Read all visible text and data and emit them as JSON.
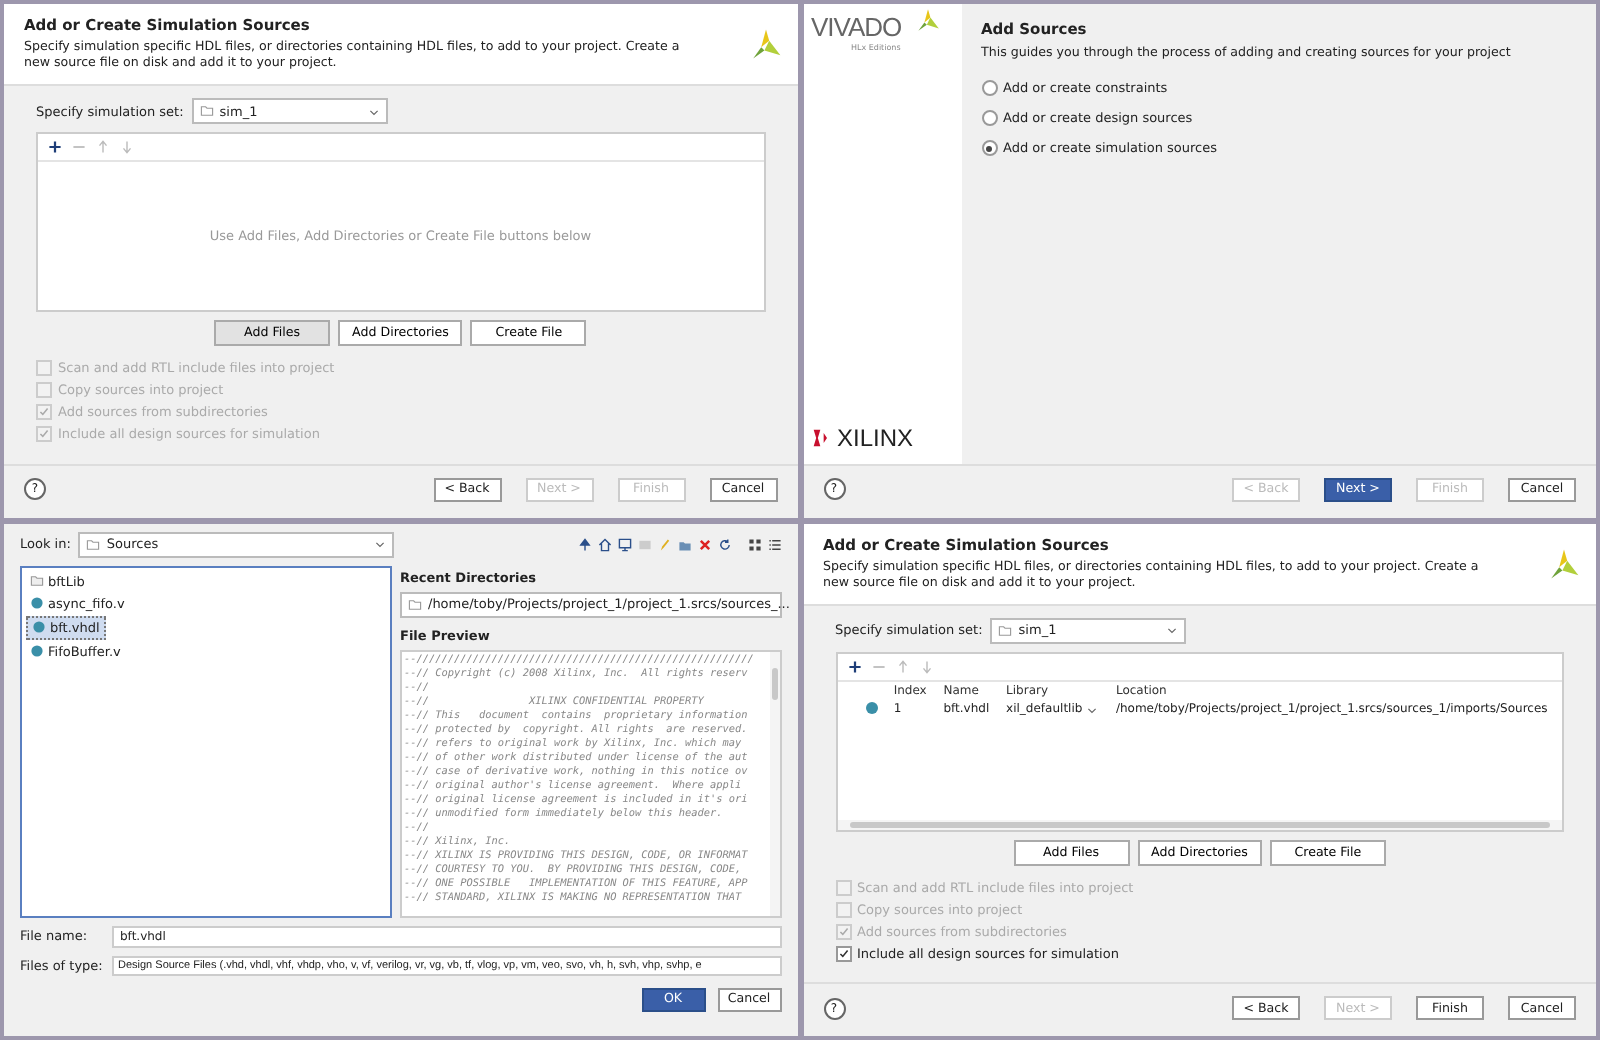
{
  "panels": [
    {
      "kind": "sources_page",
      "title": "Add or Create Simulation Sources",
      "description": "Specify simulation specific HDL files, or directories containing HDL files, to add to your project. Create a new source file on disk and add it to your project.",
      "simset_label": "Specify simulation set:",
      "simset_value": "sim_1",
      "empty_hint": "Use Add Files, Add Directories or Create File buttons below",
      "action_buttons": [
        {
          "label": "Add Files",
          "selected": true
        },
        {
          "label": "Add Directories",
          "selected": false
        },
        {
          "label": "Create File",
          "selected": false
        }
      ],
      "options": [
        {
          "label": "Scan and add RTL include files into project",
          "checked": false,
          "disabled": true
        },
        {
          "label": "Copy sources into project",
          "checked": false,
          "disabled": true
        },
        {
          "label": "Add sources from subdirectories",
          "checked": true,
          "disabled": true
        },
        {
          "label": "Include all design sources for simulation",
          "checked": true,
          "disabled": true
        }
      ],
      "help": "?",
      "nav_buttons": [
        {
          "label": "< Back",
          "disabled": false,
          "selected": false
        },
        {
          "label": "Next >",
          "disabled": true,
          "selected": false
        },
        {
          "label": "Finish",
          "disabled": true,
          "selected": false
        },
        {
          "label": "Cancel",
          "disabled": false,
          "selected": false
        }
      ]
    },
    {
      "kind": "wizard_start",
      "brand": "VIVADO",
      "edition": "HLx Editions",
      "vendor": "XILINX",
      "title": "Add Sources",
      "description": "This guides you through the process of adding and creating sources for your project",
      "choices": [
        {
          "label": "Add or create constraints",
          "selected": false
        },
        {
          "label": "Add or create design sources",
          "selected": false
        },
        {
          "label": "Add or create simulation sources",
          "selected": true
        }
      ],
      "help": "?",
      "nav_buttons": [
        {
          "label": "< Back",
          "disabled": true,
          "selected": false
        },
        {
          "label": "Next >",
          "disabled": false,
          "selected": true
        },
        {
          "label": "Finish",
          "disabled": true,
          "selected": false
        },
        {
          "label": "Cancel",
          "disabled": false,
          "selected": false
        }
      ]
    },
    {
      "kind": "file_chooser",
      "look_in_label": "Look in:",
      "look_in_value": "Sources",
      "files": [
        {
          "name": "bftLib",
          "kind": "folder",
          "selected": false
        },
        {
          "name": "async_fifo.v",
          "kind": "file",
          "selected": false
        },
        {
          "name": "bft.vhdl",
          "kind": "file",
          "selected": true
        },
        {
          "name": "FifoBuffer.v",
          "kind": "file",
          "selected": false
        }
      ],
      "recent_label": "Recent Directories",
      "recent_value": "/home/toby/Projects/project_1/project_1.srcs/sources_...",
      "preview_label": "File Preview",
      "preview_lines": [
        "--//////////////////////////////////////////////////////",
        "--// Copyright (c) 2008 Xilinx, Inc.  All rights reserv",
        "--//",
        "--//                XILINX CONFIDENTIAL PROPERTY",
        "--// This   document  contains  proprietary information",
        "--// protected by  copyright. All rights  are reserved.",
        "--// refers to original work by Xilinx, Inc. which may",
        "--// of other work distributed under license of the aut",
        "--// case of derivative work, nothing in this notice ov",
        "--// original author's license agreement.  Where appli",
        "--// original license agreement is included in it's ori",
        "--// unmodified form immediately below this header.",
        "--//",
        "--// Xilinx, Inc.",
        "--// XILINX IS PROVIDING THIS DESIGN, CODE, OR INFORMAT",
        "--// COURTESY TO YOU.  BY PROVIDING THIS DESIGN, CODE,",
        "--// ONE POSSIBLE   IMPLEMENTATION OF THIS FEATURE, APP",
        "--// STANDARD, XILINX IS MAKING NO REPRESENTATION THAT"
      ],
      "file_name_label": "File name:",
      "file_name": "bft.vhdl",
      "file_type_label": "Files of type:",
      "file_type": "Design Source Files (.vhd, vhdl, vhf, vhdp, vho, v, vf, verilog, vr, vg, vb, tf, vlog, vp, vm, veo, svo, vh, h, svh, vhp, svhp, e",
      "buttons": [
        {
          "label": "OK",
          "selected": true
        },
        {
          "label": "Cancel",
          "selected": false
        }
      ]
    },
    {
      "kind": "sources_page",
      "title": "Add or Create Simulation Sources",
      "description": "Specify simulation specific HDL files, or directories containing HDL files, to add to your project. Create a new source file on disk and add it to your project.",
      "simset_label": "Specify simulation set:",
      "simset_value": "sim_1",
      "columns": [
        "Index",
        "Name",
        "Library",
        "Location"
      ],
      "rows": [
        {
          "color": "#3a8fa8",
          "index": "1",
          "name": "bft.vhdl",
          "library": "xil_defaultlib",
          "location": "/home/toby/Projects/project_1/project_1.srcs/sources_1/imports/Sources"
        }
      ],
      "action_buttons": [
        {
          "label": "Add Files",
          "selected": false
        },
        {
          "label": "Add Directories",
          "selected": false
        },
        {
          "label": "Create File",
          "selected": false
        }
      ],
      "options": [
        {
          "label": "Scan and add RTL include files into project",
          "checked": false,
          "disabled": true
        },
        {
          "label": "Copy sources into project",
          "checked": false,
          "disabled": true
        },
        {
          "label": "Add sources from subdirectories",
          "checked": true,
          "disabled": true
        },
        {
          "label": "Include all design sources for simulation",
          "checked": true,
          "disabled": false
        }
      ],
      "help": "?",
      "nav_buttons": [
        {
          "label": "< Back",
          "disabled": false,
          "selected": false
        },
        {
          "label": "Next >",
          "disabled": true,
          "selected": false
        },
        {
          "label": "Finish",
          "disabled": false,
          "selected": false
        },
        {
          "label": "Cancel",
          "disabled": false,
          "selected": false
        }
      ]
    }
  ]
}
